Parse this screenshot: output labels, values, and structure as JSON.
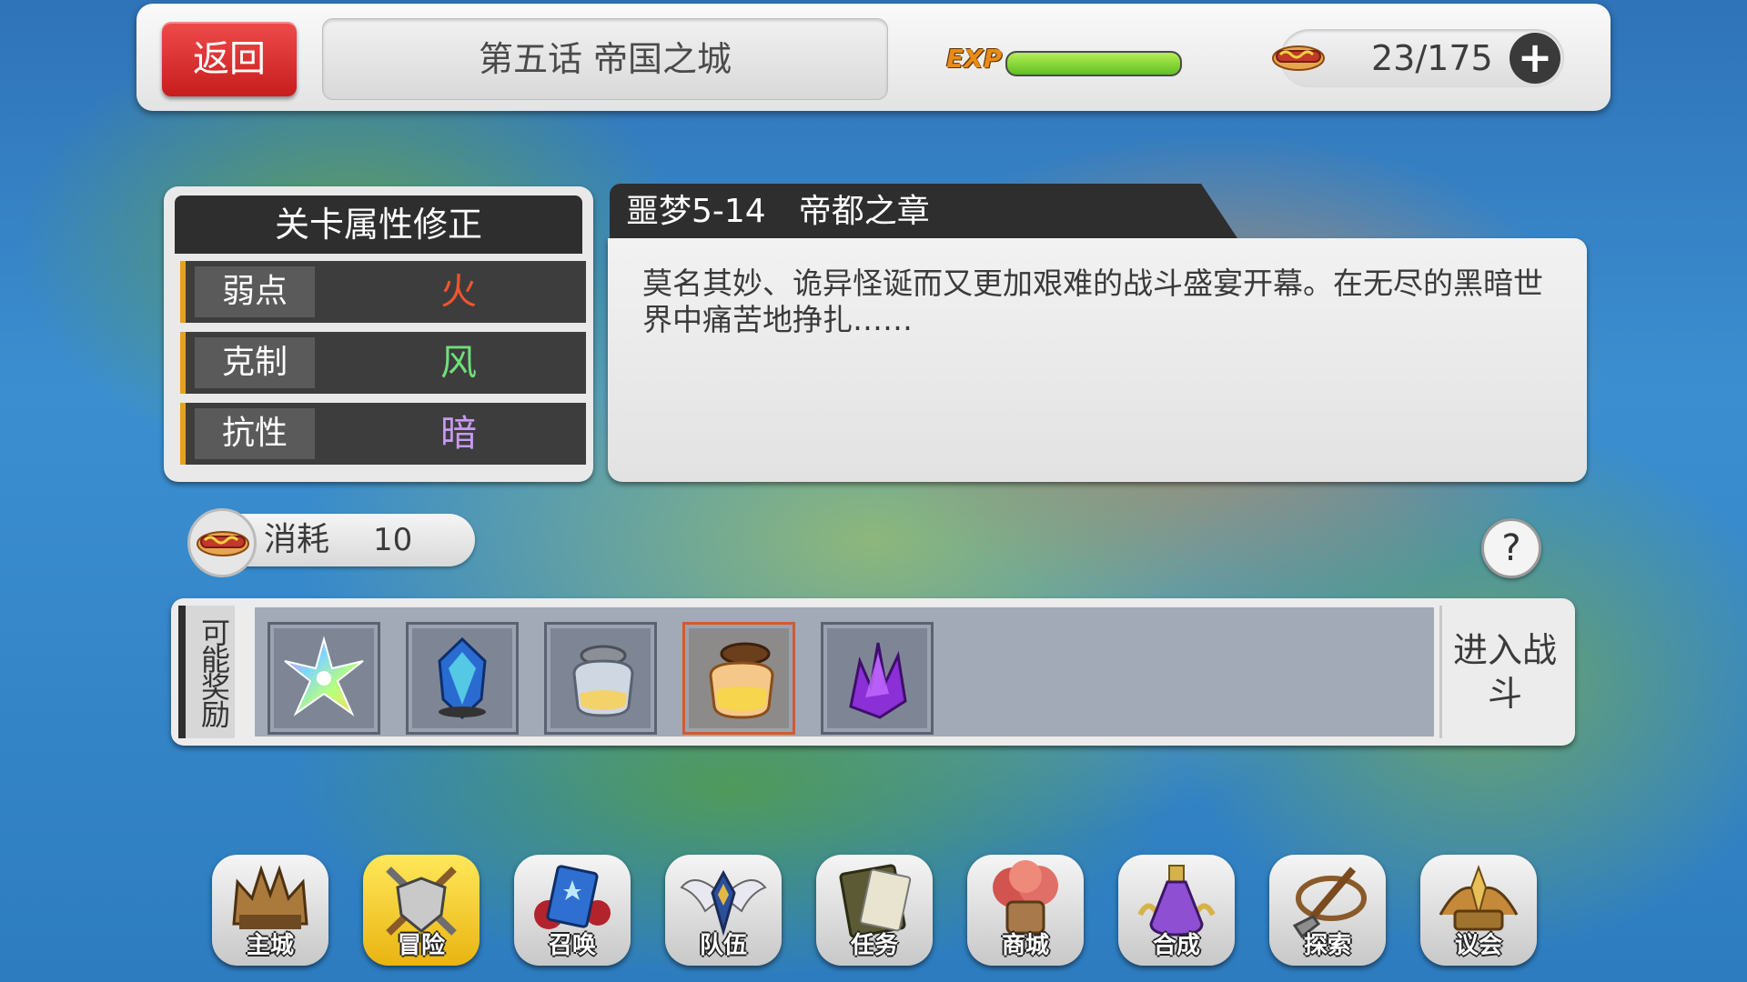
{
  "topbar": {
    "back_label": "返回",
    "chapter_title": "第五话 帝国之城",
    "exp_label": "EXP",
    "exp_progress": 1.0,
    "stamina": "23/175",
    "plus_symbol": "+"
  },
  "attributes": {
    "title": "关卡属性修正",
    "rows": [
      {
        "label": "弱点",
        "value": "火",
        "color": "#f0552f"
      },
      {
        "label": "克制",
        "value": "风",
        "color": "#6fe07a"
      },
      {
        "label": "抗性",
        "value": "暗",
        "color": "#c89af0"
      }
    ]
  },
  "stage": {
    "name": "噩梦5-14　帝都之章",
    "description": "莫名其妙、诡异怪诞而又更加艰难的战斗盛宴开幕。在无尽的黑暗世界中痛苦地挣扎……"
  },
  "cost": {
    "label": "消耗",
    "value": "10"
  },
  "help_symbol": "?",
  "rewards": {
    "label": "可能奖励",
    "items": [
      {
        "icon": "rainbow-star-icon"
      },
      {
        "icon": "blue-crystal-icon"
      },
      {
        "icon": "silver-jar-icon"
      },
      {
        "icon": "golden-jar-icon",
        "highlighted": true
      },
      {
        "icon": "purple-crystal-icon"
      }
    ]
  },
  "enter_battle": "进入战斗",
  "nav": [
    {
      "label": "主城",
      "icon": "castle-crown-icon"
    },
    {
      "label": "冒险",
      "icon": "sword-shield-icon",
      "active": true
    },
    {
      "label": "召唤",
      "icon": "summon-card-icon"
    },
    {
      "label": "队伍",
      "icon": "winged-emblem-icon"
    },
    {
      "label": "任务",
      "icon": "quest-book-icon"
    },
    {
      "label": "商城",
      "icon": "shop-tree-icon"
    },
    {
      "label": "合成",
      "icon": "potion-icon"
    },
    {
      "label": "探索",
      "icon": "shovel-icon"
    },
    {
      "label": "议会",
      "icon": "council-crest-icon"
    }
  ]
}
